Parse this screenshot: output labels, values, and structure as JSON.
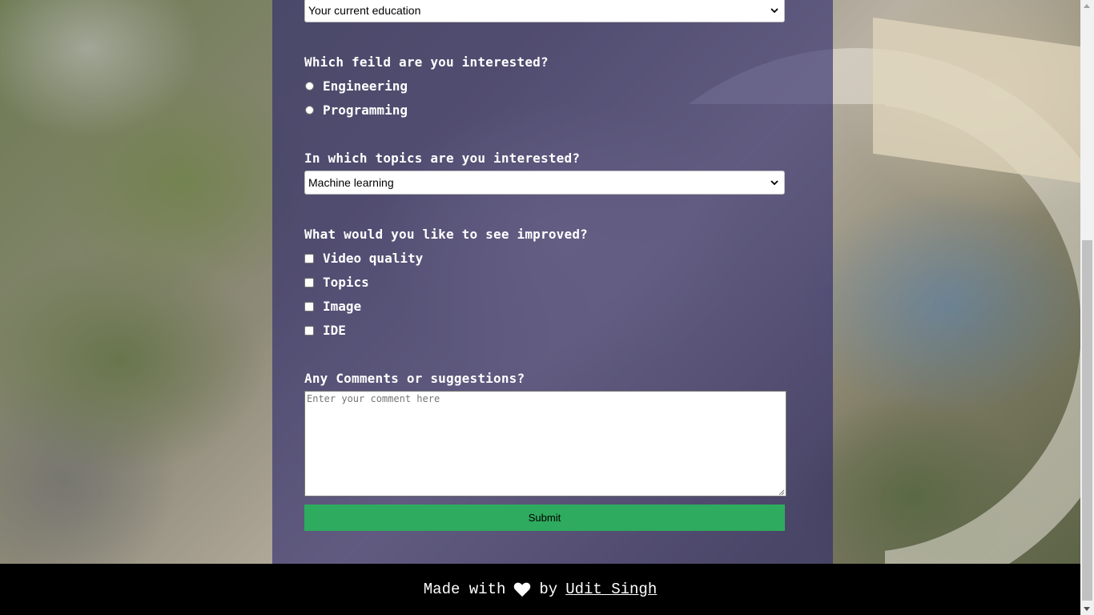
{
  "form": {
    "education_select": {
      "value": "Your current education"
    },
    "field_question": "Which feild are you interested?",
    "field_options": [
      "Engineering",
      "Programming"
    ],
    "topics_question": "In which topics are you interested?",
    "topics_select": {
      "value": "Machine learning"
    },
    "improve_question": "What would you like to see improved?",
    "improve_options": [
      "Video quality",
      "Topics",
      "Image",
      "IDE"
    ],
    "comments_question": "Any Comments or suggestions?",
    "comments_placeholder": "Enter your comment here",
    "submit_label": "Submit"
  },
  "footer": {
    "made_with": "Made with",
    "by": "by",
    "author": "Udit Singh"
  },
  "colors": {
    "panel": "#2c266c",
    "submit": "#2eab5e",
    "footer_bg": "#000000"
  },
  "icons": [
    "chevron-down-icon",
    "heart-icon"
  ]
}
